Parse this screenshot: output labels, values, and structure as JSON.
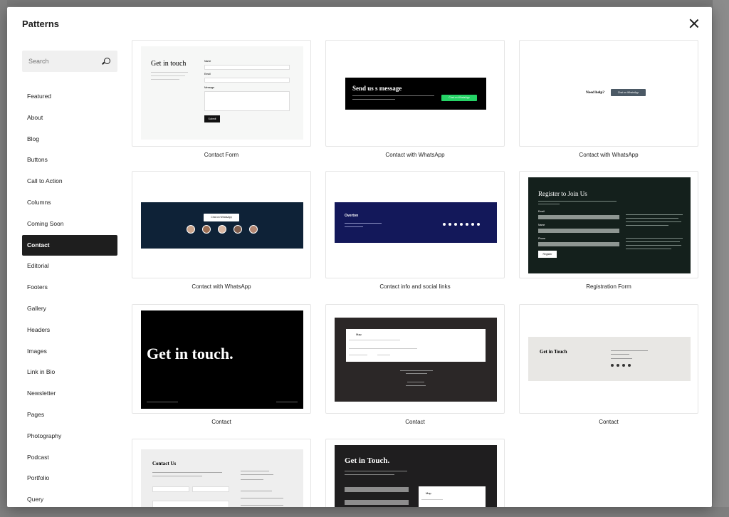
{
  "modal": {
    "title": "Patterns",
    "search_placeholder": "Search"
  },
  "categories": [
    "Featured",
    "About",
    "Blog",
    "Buttons",
    "Call to Action",
    "Columns",
    "Coming Soon",
    "Contact",
    "Editorial",
    "Footers",
    "Gallery",
    "Headers",
    "Images",
    "Link in Bio",
    "Newsletter",
    "Pages",
    "Photography",
    "Podcast",
    "Portfolio",
    "Query"
  ],
  "active_category": "Contact",
  "patterns": [
    {
      "label": "Contact Form"
    },
    {
      "label": "Contact with WhatsApp"
    },
    {
      "label": "Contact with WhatsApp"
    },
    {
      "label": "Contact with WhatsApp"
    },
    {
      "label": "Contact info and social links"
    },
    {
      "label": "Registration Form"
    },
    {
      "label": "Contact"
    },
    {
      "label": "Contact"
    },
    {
      "label": "Contact"
    },
    {
      "label": ""
    },
    {
      "label": ""
    }
  ],
  "previews": {
    "p1": {
      "heading": "Get in touch",
      "name": "Name",
      "email": "Email",
      "message": "Message",
      "submit": "Submit"
    },
    "p2": {
      "heading": "Send us s message",
      "button": "Chat on WhatsApp"
    },
    "p3": {
      "text": "Need help?",
      "button": "Chat on WhatsApp"
    },
    "p4": {
      "button": "Chat on WhatsApp"
    },
    "p5": {
      "title": "Overton"
    },
    "p6": {
      "heading": "Register to Join Us",
      "email": "Email",
      "name": "Name",
      "phone": "Phone",
      "button": "Register"
    },
    "p7": {
      "heading": "Get in touch."
    },
    "p8": {
      "label": "Map"
    },
    "p9": {
      "heading": "Get in Touch"
    },
    "p10": {
      "heading": "Contact Us"
    },
    "p11": {
      "heading": "Get in Touch.",
      "map": "Map"
    }
  },
  "colors": {
    "accent_dark": "#1e1e1e",
    "whatsapp_green": "#25d366",
    "navy": "#13185a",
    "teal_dark": "#0e2237",
    "forest": "#14201c"
  }
}
